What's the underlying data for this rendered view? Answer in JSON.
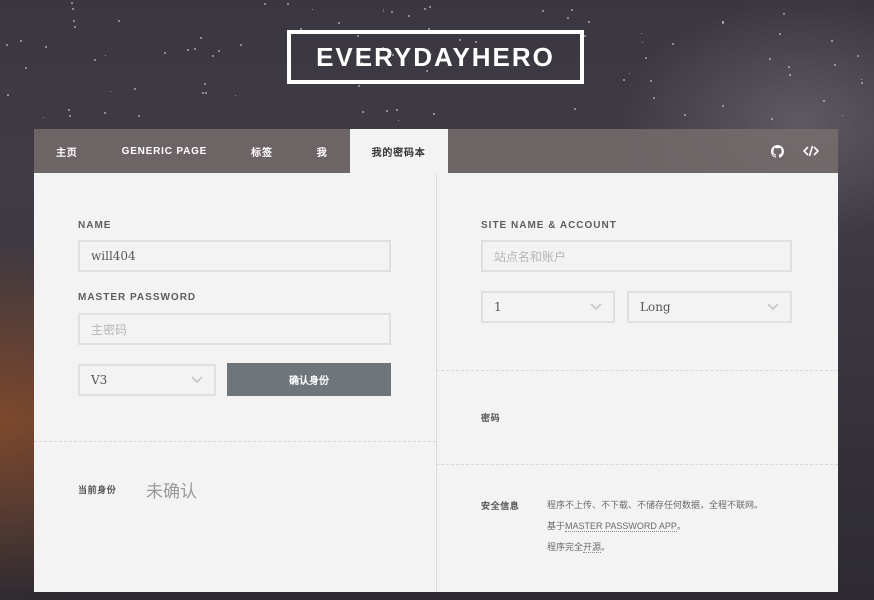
{
  "brand": {
    "title": "EVERYDAYHERO"
  },
  "nav": {
    "items": [
      {
        "label": "主页",
        "name": "nav-item-home",
        "active": false
      },
      {
        "label": "GENERIC PAGE",
        "name": "nav-item-generic-page",
        "active": false
      },
      {
        "label": "标签",
        "name": "nav-item-tags",
        "active": false
      },
      {
        "label": "我",
        "name": "nav-item-me",
        "active": false
      },
      {
        "label": "我的密码本",
        "name": "nav-item-password-book",
        "active": true
      }
    ],
    "icons": [
      "github-icon",
      "code-icon"
    ]
  },
  "left": {
    "name_label": "NAME",
    "name_value": "will404",
    "master_label": "MASTER PASSWORD",
    "master_placeholder": "主密码",
    "version_value": "V3",
    "confirm_button": "确认身份",
    "identity_label": "当前身份",
    "identity_value": "未确认"
  },
  "right": {
    "site_label": "SITE NAME & ACCOUNT",
    "site_placeholder": "站点名和账户",
    "counter_value": "1",
    "type_value": "Long",
    "password_label": "密码",
    "security_label": "安全信息",
    "security_line1": "程序不上传、不下载、不储存任何数据，全程不联网。",
    "security_line2_prefix": "基于",
    "security_line2_link": "MASTER PASSWORD APP",
    "security_line2_suffix": "。",
    "security_line3_prefix": "程序完全",
    "security_line3_link": "开源",
    "security_line3_suffix": "。"
  },
  "colors": {
    "button": "#6e757b",
    "panel": "#f3f3f3",
    "nav": "#786e6e"
  }
}
